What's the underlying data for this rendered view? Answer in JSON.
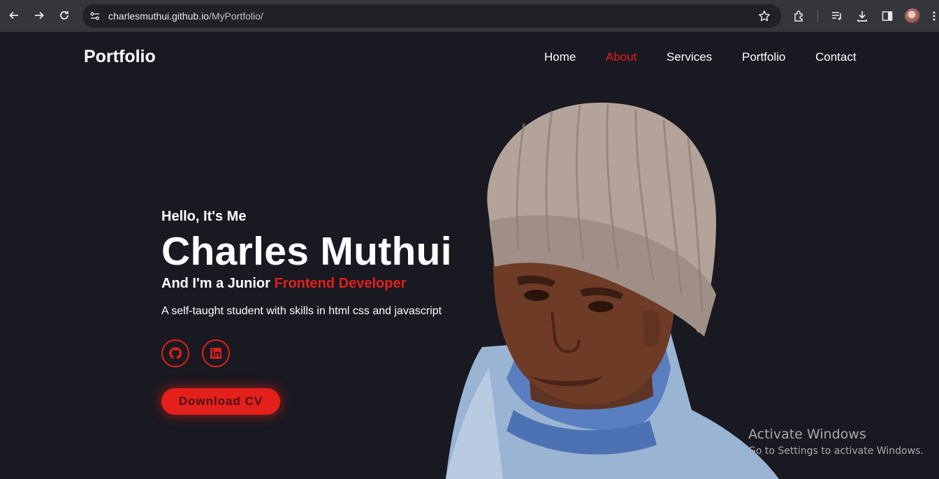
{
  "browser": {
    "url_host": "charlesmuthui.github.io",
    "url_path": "/MyPortfolio/",
    "icons": [
      "back-icon",
      "forward-icon",
      "reload-icon",
      "site-info-icon",
      "bookmark-star-icon",
      "extensions-icon",
      "reading-list-icon",
      "download-icon",
      "side-panel-icon",
      "profile-avatar",
      "more-menu-icon"
    ]
  },
  "header": {
    "logo": "Portfolio",
    "nav": [
      {
        "label": "Home",
        "active": false
      },
      {
        "label": "About",
        "active": true
      },
      {
        "label": "Services",
        "active": false
      },
      {
        "label": "Portfolio",
        "active": false
      },
      {
        "label": "Contact",
        "active": false
      }
    ]
  },
  "hero": {
    "greeting": "Hello, It's Me",
    "name": "Charles Muthui",
    "role_prefix": "And I'm a Junior ",
    "role_accent": "Frontend Developer",
    "description": "A self-taught student with skills in html css and javascript",
    "social": [
      "github-icon",
      "linkedin-icon"
    ],
    "cta": "Download CV"
  },
  "os_overlay": {
    "title": "Activate Windows",
    "subtitle": "Go to Settings to activate Windows."
  },
  "colors": {
    "accent": "#e3201b",
    "background": "#191921",
    "text": "#ffffff"
  }
}
